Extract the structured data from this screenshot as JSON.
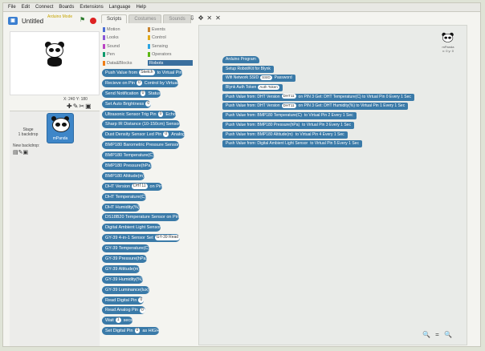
{
  "menu": [
    "File",
    "Edit",
    "Connect",
    "Boards",
    "Extensions",
    "Language",
    "Help"
  ],
  "project": {
    "title": "Untitled",
    "subtitle": "Arduino Mode"
  },
  "stage": {
    "coords": "X: 240  Y: 180"
  },
  "sprites": {
    "stage_label": "Stage",
    "stage_sub": "1 backdrop",
    "new_backdrop": "New backdrop:",
    "sprite_name": "mPanda"
  },
  "tabs": [
    "Scripts",
    "Costumes",
    "Sounds"
  ],
  "categories": [
    {
      "label": "Motion",
      "color": "#4a6cd4"
    },
    {
      "label": "Events",
      "color": "#c88330"
    },
    {
      "label": "Looks",
      "color": "#8a55d7"
    },
    {
      "label": "Control",
      "color": "#e1a91a"
    },
    {
      "label": "Sound",
      "color": "#bb42c3"
    },
    {
      "label": "Sensing",
      "color": "#2ca5e2"
    },
    {
      "label": "Pen",
      "color": "#0e9a6c"
    },
    {
      "label": "Operators",
      "color": "#5cb712"
    },
    {
      "label": "Data&Blocks",
      "color": "#ee7d16"
    },
    {
      "label": "Robots",
      "color": "#3a6f9e"
    }
  ],
  "palette": [
    {
      "text": "Push Value from",
      "slot": "Sketch",
      "text2": "to Virtual Pin"
    },
    {
      "text": "Recieve on Pin",
      "slot": "0",
      "text2": "Control by Virtual"
    },
    {
      "text": "Send Notification",
      "slot": "0",
      "text2": "Status"
    },
    {
      "text": "Set Auto Brightness",
      "slot": "0",
      "text2": ""
    },
    {
      "text": "Ultrasonic Sensor Trig Pin",
      "slot": "0",
      "text2": "Echo"
    },
    {
      "text": "Sharp IR Distance (10-150cm) Sensor",
      "slot": "",
      "text2": ""
    },
    {
      "text": "Dust Density Sensor Led Pin",
      "slot": "0",
      "text2": "Analog"
    },
    {
      "text": "BMP180 Barometric Pressure Sensor",
      "slot": "",
      "text2": ""
    },
    {
      "text": "BMP180 Temperature(C)",
      "slot": "",
      "text2": ""
    },
    {
      "text": "BMP180 Pressure(hPa)",
      "slot": "",
      "text2": ""
    },
    {
      "text": "BMP180 Altitude(m)",
      "slot": "",
      "text2": ""
    },
    {
      "text": "DHT Version",
      "slot": "DHT11",
      "text2": "on Pin"
    },
    {
      "text": "DHT Temperature(C)",
      "slot": "",
      "text2": ""
    },
    {
      "text": "DHT Humidity(%)",
      "slot": "",
      "text2": ""
    },
    {
      "text": "DS18B20 Temperature Sensor on Pin",
      "slot": "",
      "text2": ""
    },
    {
      "text": "Digital Ambient Light Sensor",
      "slot": "",
      "text2": ""
    },
    {
      "text": "GY-39 4-in-1 Sensor Set",
      "slot": "GY-39 Read",
      "text2": ""
    },
    {
      "text": "GY-39 Temperature(C)",
      "slot": "",
      "text2": ""
    },
    {
      "text": "GY-39 Pressure(hPa)",
      "slot": "",
      "text2": ""
    },
    {
      "text": "GY-39 Altitude(m)",
      "slot": "",
      "text2": ""
    },
    {
      "text": "GY-39 Humidity(%)",
      "slot": "",
      "text2": ""
    },
    {
      "text": "GY-39 Luminance(lux)",
      "slot": "",
      "text2": ""
    },
    {
      "text": "Read Digital Pin",
      "slot": "0",
      "text2": ""
    },
    {
      "text": "Read Analog Pin",
      "slot": "0",
      "text2": ""
    },
    {
      "text": "Wait",
      "slot": "1",
      "text2": "secs"
    },
    {
      "text": "Set Digital Pin",
      "slot": "0",
      "text2": "as HIGH"
    }
  ],
  "script": [
    {
      "text": "Arduino Program",
      "slot": "",
      "text2": ""
    },
    {
      "text": "Setup Robot/Kit for Blynk",
      "slot": "",
      "text2": ""
    },
    {
      "text": "Wifi Network SSID",
      "slot": "SSID",
      "text2": "Password"
    },
    {
      "text": "Blynk Auth Token",
      "slot": "Auth Token",
      "text2": ""
    },
    {
      "text": "Push Value from: DHT Version",
      "slot": "DHT11",
      "text2": "on PIN 3  Get: DHT Temperature(C)  to Virtual Pin 0  Every 1 Sec"
    },
    {
      "text": "Push Value from: DHT Version",
      "slot": "DHT11",
      "text2": "on PIN 3  Get: DHT Humidity(%)  to Virtual Pin 1  Every 1 Sec"
    },
    {
      "text": "Push Value from: BMP180 Temperature(C)",
      "slot": "",
      "text2": "to Virtual Pin 2  Every 1 Sec"
    },
    {
      "text": "Push Value from: BMP180 Pressure(hPa)",
      "slot": "",
      "text2": "to Virtual Pin 3  Every 1 Sec"
    },
    {
      "text": "Push Value from: BMP180 Altitude(m)",
      "slot": "",
      "text2": "to Virtual Pin 4  Every 1 Sec"
    },
    {
      "text": "Push Value from: Digital Ambient Light Sensor",
      "slot": "",
      "text2": "to Virtual Pin 5  Every 1 Sec"
    }
  ],
  "preview": {
    "label": "mPanda",
    "xy": "x: 0  y: 0"
  },
  "zoom_icons": "🔍 = 🔍",
  "colors": {
    "block": "#3a7aa8",
    "selected_tab": "#3a6f9e"
  }
}
